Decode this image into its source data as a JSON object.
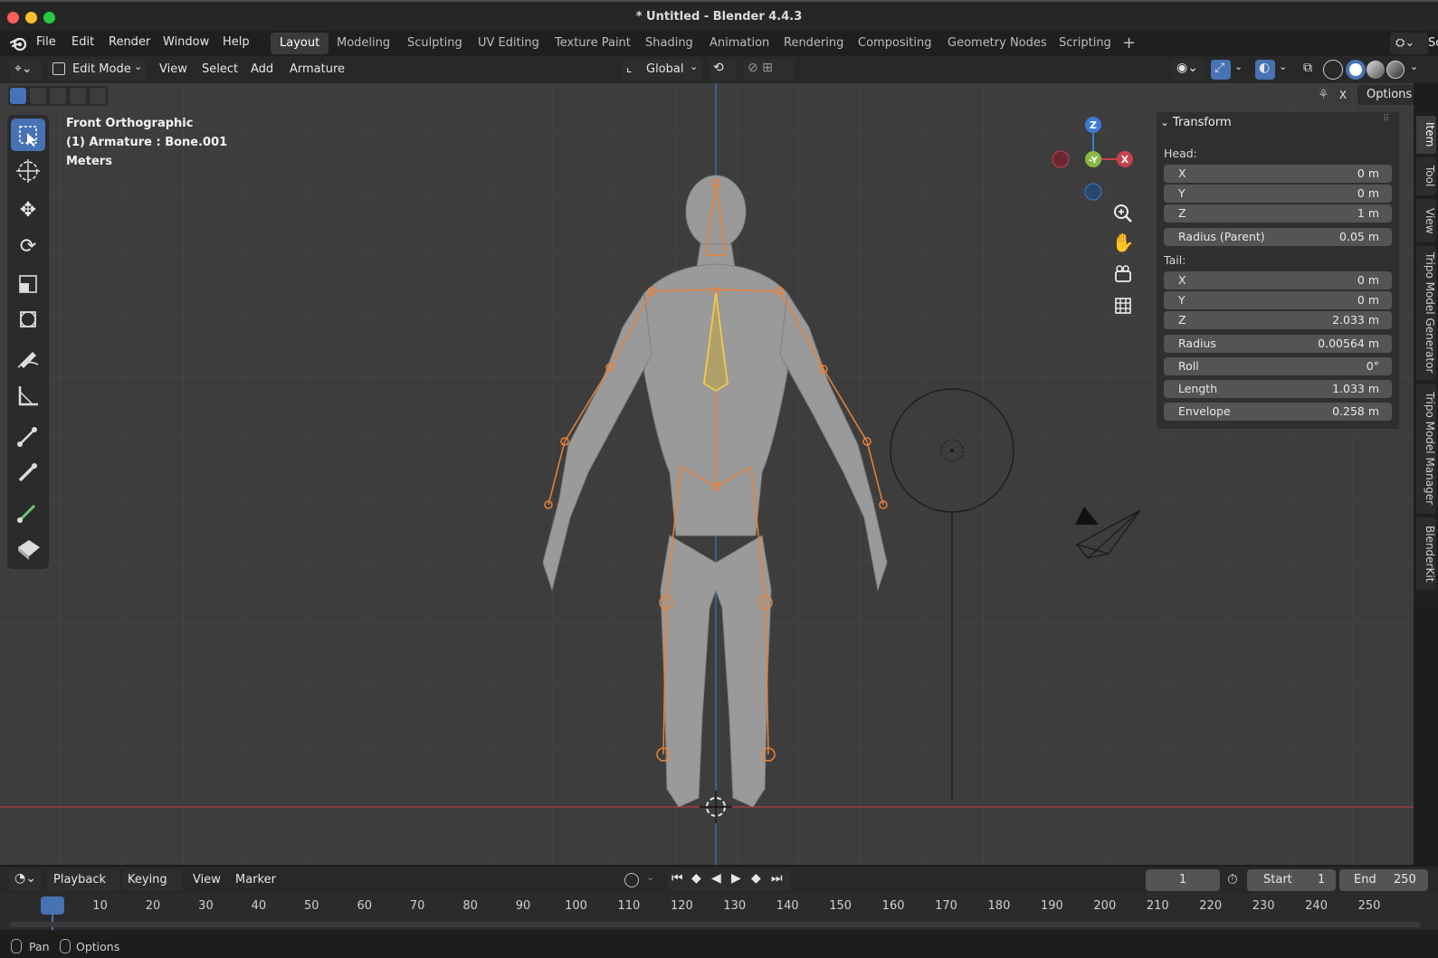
{
  "window": {
    "title": "* Untitled - Blender 4.4.3"
  },
  "menubar": {
    "items": [
      "File",
      "Edit",
      "Render",
      "Window",
      "Help"
    ],
    "workspaces": [
      "Layout",
      "Modeling",
      "Sculpting",
      "UV Editing",
      "Texture Paint",
      "Shading",
      "Animation",
      "Rendering",
      "Compositing",
      "Geometry Nodes",
      "Scripting"
    ],
    "active_workspace": "Layout",
    "scene_partial": "Sc"
  },
  "header3d": {
    "mode": "Edit Mode",
    "menus": [
      "View",
      "Select",
      "Add",
      "Armature"
    ],
    "orientation": "Global",
    "options_label": "Options",
    "x_label": "X"
  },
  "viewport": {
    "view_name": "Front Orthographic",
    "object_info": "(1) Armature : Bone.001",
    "units": "Meters",
    "gizmo": {
      "z": "Z",
      "y": "-Y",
      "x": "X"
    }
  },
  "npanel": {
    "section": "Transform",
    "head_label": "Head:",
    "head": [
      {
        "label": "X",
        "value": "0 m"
      },
      {
        "label": "Y",
        "value": "0 m"
      },
      {
        "label": "Z",
        "value": "1 m"
      }
    ],
    "radius_parent": {
      "label": "Radius (Parent)",
      "value": "0.05 m"
    },
    "tail_label": "Tail:",
    "tail": [
      {
        "label": "X",
        "value": "0 m"
      },
      {
        "label": "Y",
        "value": "0 m"
      },
      {
        "label": "Z",
        "value": "2.033 m"
      }
    ],
    "props": [
      {
        "label": "Radius",
        "value": "0.00564 m"
      },
      {
        "label": "Roll",
        "value": "0°"
      },
      {
        "label": "Length",
        "value": "1.033 m"
      },
      {
        "label": "Envelope",
        "value": "0.258 m"
      }
    ]
  },
  "side_tabs": [
    "Item",
    "Tool",
    "View",
    "Tripo Model Generator",
    "Tripo Model Manager",
    "BlenderKit"
  ],
  "timeline": {
    "menus": [
      "Playback",
      "Keying",
      "View",
      "Marker"
    ],
    "current_frame": "1",
    "start_label": "Start",
    "start_value": "1",
    "end_label": "End",
    "end_value": "250",
    "ticks": [
      "1",
      "10",
      "20",
      "30",
      "40",
      "50",
      "60",
      "70",
      "80",
      "90",
      "100",
      "110",
      "120",
      "130",
      "140",
      "150",
      "160",
      "170",
      "180",
      "190",
      "200",
      "210",
      "220",
      "230",
      "240",
      "250"
    ]
  },
  "statusbar": {
    "pan": "Pan",
    "options": "Options"
  },
  "colors": {
    "accent": "#4772b3",
    "bone": "#e8833a",
    "active_bone": "#f2c94c",
    "axis_x": "#c8424d",
    "axis_y": "#8ab846",
    "axis_z": "#3f7ad1"
  }
}
